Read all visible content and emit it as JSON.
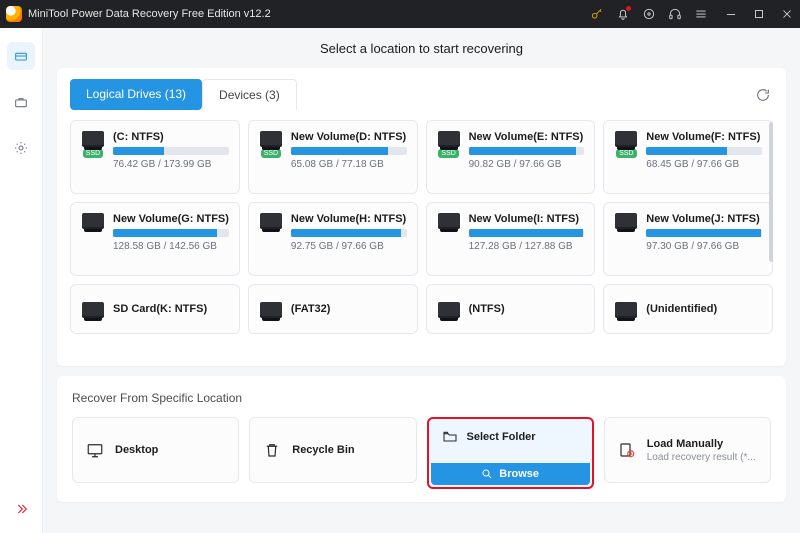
{
  "titlebar": {
    "title": "MiniTool Power Data Recovery Free Edition v12.2"
  },
  "header": {
    "subtitle": "Select a location to start recovering"
  },
  "tabs": {
    "logical": "Logical Drives (13)",
    "devices": "Devices (3)"
  },
  "ssd_badge": "SSD",
  "drives": [
    {
      "name": "(C: NTFS)",
      "used": 76.42,
      "total": 173.99,
      "size": "76.42 GB / 173.99 GB",
      "ssd": true,
      "pct": 44
    },
    {
      "name": "New Volume(D: NTFS)",
      "used": 65.08,
      "total": 77.18,
      "size": "65.08 GB / 77.18 GB",
      "ssd": true,
      "pct": 84
    },
    {
      "name": "New Volume(E: NTFS)",
      "used": 90.82,
      "total": 97.66,
      "size": "90.82 GB / 97.66 GB",
      "ssd": true,
      "pct": 93
    },
    {
      "name": "New Volume(F: NTFS)",
      "used": 68.45,
      "total": 97.66,
      "size": "68.45 GB / 97.66 GB",
      "ssd": true,
      "pct": 70
    },
    {
      "name": "New Volume(G: NTFS)",
      "used": 128.58,
      "total": 142.56,
      "size": "128.58 GB / 142.56 GB",
      "ssd": false,
      "pct": 90
    },
    {
      "name": "New Volume(H: NTFS)",
      "used": 92.75,
      "total": 97.66,
      "size": "92.75 GB / 97.66 GB",
      "ssd": false,
      "pct": 95
    },
    {
      "name": "New Volume(I: NTFS)",
      "used": 127.28,
      "total": 127.88,
      "size": "127.28 GB / 127.88 GB",
      "ssd": false,
      "pct": 99
    },
    {
      "name": "New Volume(J: NTFS)",
      "used": 97.3,
      "total": 97.66,
      "size": "97.30 GB / 97.66 GB",
      "ssd": false,
      "pct": 99
    }
  ],
  "drives_row3": [
    {
      "name": "SD Card(K: NTFS)"
    },
    {
      "name": "(FAT32)"
    },
    {
      "name": "(NTFS)"
    },
    {
      "name": "(Unidentified)"
    }
  ],
  "panel2": {
    "title": "Recover From Specific Location",
    "locations": {
      "desktop": "Desktop",
      "recycle": "Recycle Bin",
      "select_folder": "Select Folder",
      "browse": "Browse",
      "load_manually": "Load Manually",
      "load_sub": "Load recovery result (*..."
    }
  }
}
